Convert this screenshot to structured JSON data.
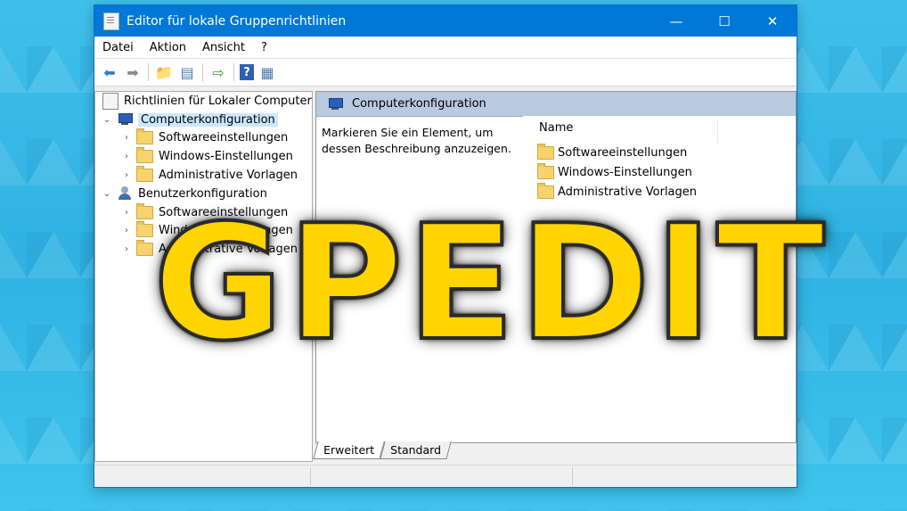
{
  "window": {
    "title": "Editor für lokale Gruppenrichtlinien"
  },
  "menu": [
    "Datei",
    "Aktion",
    "Ansicht",
    "?"
  ],
  "tree": {
    "root": "Richtlinien für Lokaler Computer",
    "computer": "Computerkonfiguration",
    "computer_children": [
      "Softwareeinstellungen",
      "Windows-Einstellungen",
      "Administrative Vorlagen"
    ],
    "user": "Benutzerkonfiguration",
    "user_children": [
      "Softwareeinstellungen",
      "Windows-Einstellungen",
      "Administrative Vorlagen"
    ]
  },
  "content": {
    "header": "Computerkonfiguration",
    "description": "Markieren Sie ein Element, um dessen Beschreibung anzuzeigen.",
    "column": "Name",
    "items": [
      "Softwareeinstellungen",
      "Windows-Einstellungen",
      "Administrative Vorlagen"
    ]
  },
  "tabs": [
    "Erweitert",
    "Standard"
  ],
  "overlay": "GPEDIT",
  "colors": {
    "titlebar": "#0078d7",
    "overlay": "#ffd400",
    "background": "#3fc0ea"
  }
}
